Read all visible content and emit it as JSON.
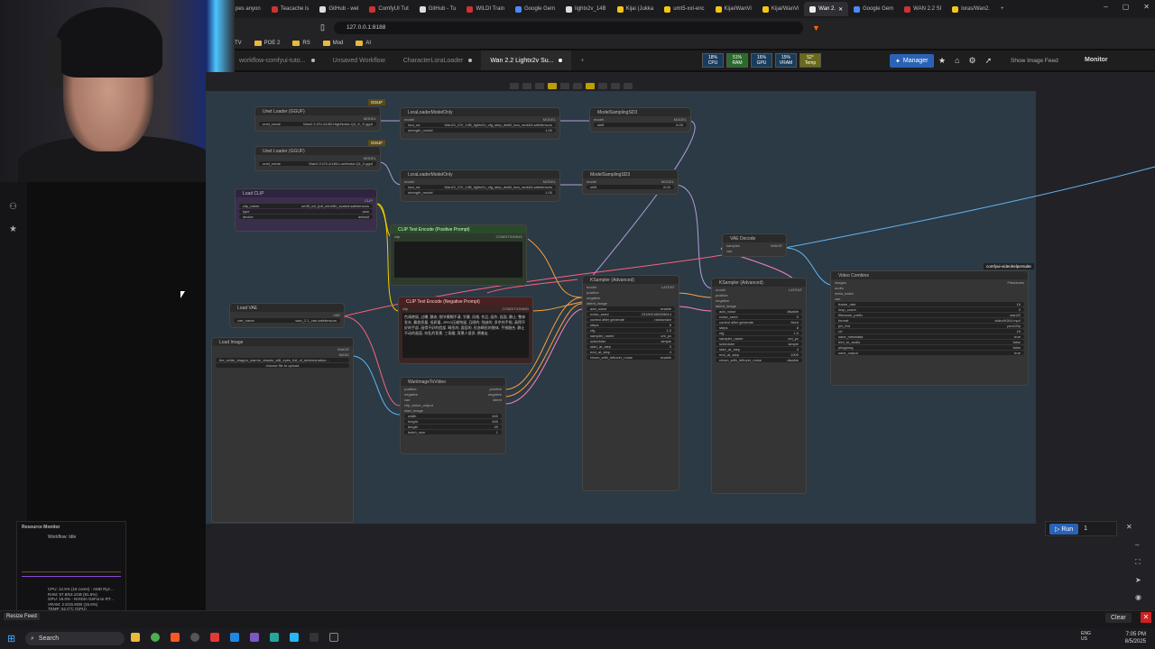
{
  "browser": {
    "tabs": [
      {
        "label": "pes anyon"
      },
      {
        "label": "Teacache is"
      },
      {
        "label": "GitHub - wel"
      },
      {
        "label": "ComfyUI Tut"
      },
      {
        "label": "GitHub - Tu"
      },
      {
        "label": "WILDI Train"
      },
      {
        "label": "Google Gem"
      },
      {
        "label": "lightx2v_14B"
      },
      {
        "label": "Kijai (Jukka"
      },
      {
        "label": "umt5-xxl-enc"
      },
      {
        "label": "Kijai/WanVi"
      },
      {
        "label": "Kijai/WanVi"
      },
      {
        "label": "Wan 2."
      },
      {
        "label": "Google Gem"
      },
      {
        "label": "WAN 2.2 SI"
      },
      {
        "label": "loras/Wan2."
      }
    ],
    "url": "127.0.0.1:8188",
    "bookmarks": [
      "thTV",
      "POE 2",
      "RS",
      "Mod",
      "AI"
    ]
  },
  "comfy": {
    "workflow_tabs": [
      "workflow-comfyui-tuto...",
      "Unsaved Workflow",
      "CharacterLoraLoader",
      "Wan 2.2 Lightx2v Su..."
    ],
    "stats": [
      {
        "label": "CPU",
        "value": "18%"
      },
      {
        "label": "RAM",
        "value": "51%"
      },
      {
        "label": "GPU",
        "value": "16%"
      },
      {
        "label": "VRAM",
        "value": "15%"
      },
      {
        "label": "Temp",
        "value": "52°"
      }
    ],
    "manager_label": "Manager",
    "image_feed_label": "Show Image Feed",
    "monitor_label": "Monitor",
    "run_label": "Run",
    "run_count": "1",
    "clear_label": "Clear",
    "resize_label": "Resize Feed"
  },
  "nodes": {
    "unet1": {
      "title": "Unet Loader (GGUF)",
      "output": "MODEL",
      "widget": "Wan2.2-I2V-A14B-HighNoise-Q4_K_S.gguf",
      "badge": "GGUF"
    },
    "unet2": {
      "title": "Unet Loader (GGUF)",
      "output": "MODEL",
      "widget": "Wan2.2-I2V-A14B-LowNoise-Q4_0.gguf",
      "badge": "GGUF"
    },
    "lora1": {
      "title": "LoraLoaderModelOnly",
      "lora": "Wan21_I2V_14B_lightx2v_cfg_step_distill_lora_rank64.safetensors",
      "strength": "1.00"
    },
    "lora2": {
      "title": "LoraLoaderModelOnly",
      "lora": "Wan21_I2V_14B_lightx2v_cfg_step_distill_lora_rank64.safetensors",
      "strength": "1.00"
    },
    "sd3a": {
      "title": "ModelSamplingSD3",
      "shift": "8.00"
    },
    "sd3b": {
      "title": "ModelSamplingSD3",
      "shift": "8.00"
    },
    "clip": {
      "title": "Load CLIP",
      "clip_name": "umt5_xxl_fp8_e4m3fn_scaled.safetensors",
      "type": "wan",
      "device": "default"
    },
    "pos": {
      "title": "CLIP Text Encode (Positive Prompt)",
      "out": "CONDITIONING"
    },
    "neg": {
      "title": "CLIP Text Encode (Negative Prompt)",
      "out": "CONDITIONING",
      "text": "色调艳丽, 过曝, 静态, 细节模糊不清, 字幕, 风格, 作品, 画作, 画面, 静止, 整体发灰, 最差质量, 低质量, JPEG压缩残留, 丑陋的, 残缺的, 多余的手指, 画得不好的手部, 画得不好的脸部, 畸形的, 毁容的, 形态畸形的肢体, 手指融合, 静止不动的画面, 杂乱的背景, 三条腿, 背景人很多, 倒着走"
    },
    "vae": {
      "title": "Load VAE",
      "vae_name": "wan_2.1_vae.safetensors",
      "out": "VAE"
    },
    "img": {
      "title": "Load Image",
      "file": "the_white_dragon_warrior_stands_still_eyes_full_of_determination...",
      "upload": "choose file to upload"
    },
    "w2v": {
      "title": "WanImageToVideo",
      "width": "640",
      "height": "640",
      "length": "49",
      "batch_size": "1"
    },
    "ks1": {
      "title": "KSampler (Advanced)",
      "add_noise": "enable",
      "noise_seed": "231900188328614",
      "control": "randomize",
      "steps": "8",
      "cfg": "1.0",
      "sampler": "uni_pc",
      "scheduler": "simple",
      "start": "0",
      "end": "4",
      "leftover": "enable"
    },
    "ks2": {
      "title": "KSampler (Advanced)",
      "add_noise": "disable",
      "noise_seed": "0",
      "control": "fixed",
      "steps": "8",
      "cfg": "1.0",
      "sampler": "uni_pc",
      "scheduler": "simple",
      "start": "4",
      "end": "1000",
      "leftover": "disable"
    },
    "vdec": {
      "title": "VAE Decode",
      "out": "IMAGE"
    },
    "vcomb": {
      "title": "Video Combine",
      "badge": "comfyui-videohelpersuite",
      "frame_rate": "16",
      "loop_count": "0",
      "prefix": "wan22",
      "format": "video/h264-mp4",
      "pix_fmt": "yuv420p",
      "crf": "19",
      "save_metadata": "true",
      "trim": "false",
      "pingpong": "false",
      "save_output": "true"
    }
  },
  "resource_monitor": {
    "title": "Resource Monitor",
    "workflow": "Workflow: Idle",
    "lines": [
      "CPU: 12.5% (16 cores) - AMD Ryz...",
      "RAM: 57.8/63.1GB (91.6%)",
      "GPU: 16.0% - NVIDIA GeForce RT...",
      "VRAM: 2.5/15.9GB (15.6%)",
      "TEMP: 52.0°C (GPU)"
    ]
  },
  "taskbar": {
    "search": "Search",
    "time": "7:05 PM",
    "date": "8/5/2025",
    "lang": "ENG US"
  }
}
